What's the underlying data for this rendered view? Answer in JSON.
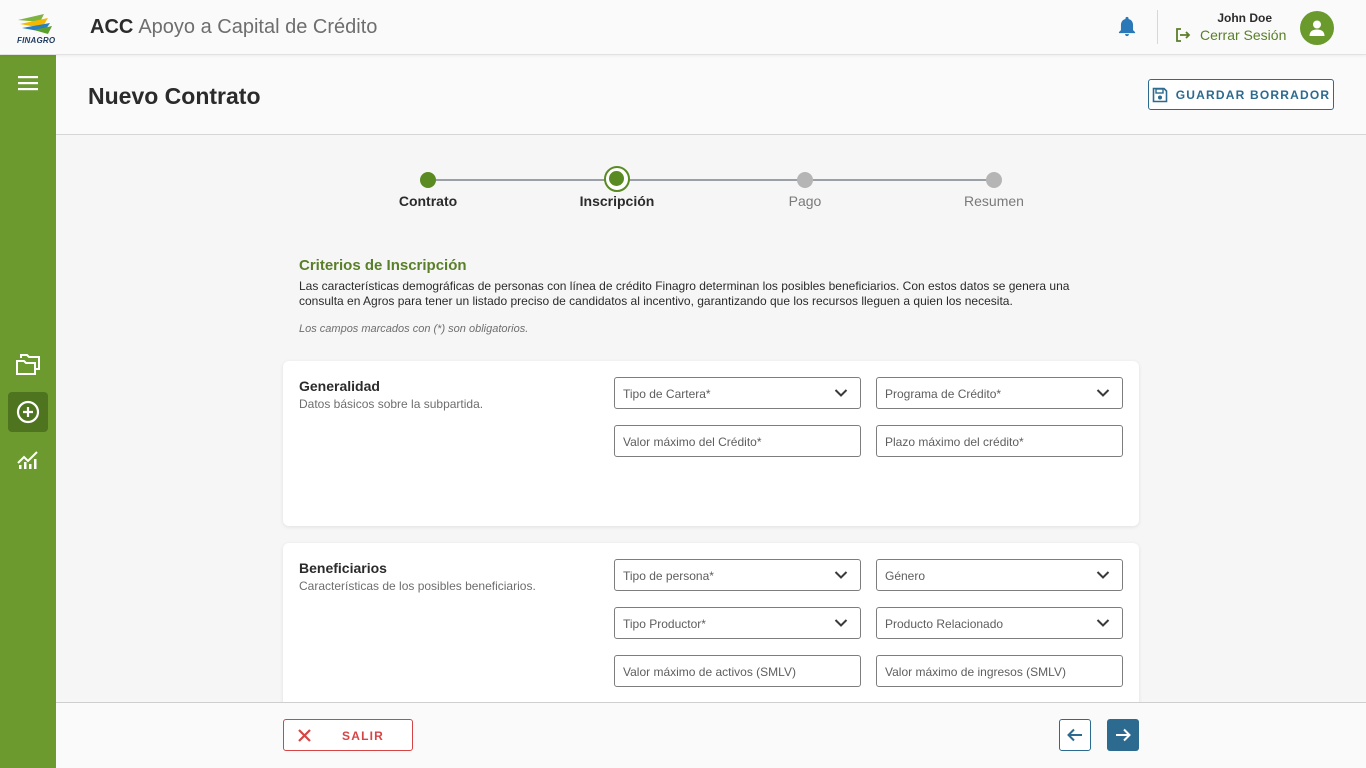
{
  "colors": {
    "brand_green": "#6d9a2f",
    "accent_blue": "#2c6a8f",
    "danger_red": "#d64545"
  },
  "header": {
    "logo_text": "FINAGRO",
    "app_code": "ACC",
    "app_name": "Apoyo a Capital de Crédito",
    "user_name": "John Doe",
    "logout_label": "Cerrar Sesión"
  },
  "sidebar": {
    "items": [
      {
        "icon": "menu-icon"
      },
      {
        "icon": "folders-icon"
      },
      {
        "icon": "add-circle-icon",
        "active": true
      },
      {
        "icon": "chart-icon"
      }
    ]
  },
  "page": {
    "title": "Nuevo Contrato",
    "save_draft_label": "GUARDAR BORRADOR"
  },
  "stepper": {
    "steps": [
      {
        "label": "Contrato",
        "status": "done"
      },
      {
        "label": "Inscripción",
        "status": "current"
      },
      {
        "label": "Pago",
        "status": "pending"
      },
      {
        "label": "Resumen",
        "status": "pending"
      }
    ]
  },
  "intro": {
    "title": "Criterios de Inscripción",
    "text": "Las características demográficas de personas con línea de crédito Finagro determinan los posibles beneficiarios. Con estos datos se genera una consulta en Agros para tener un listado preciso de candidatos al incentivo, garantizando que los recursos lleguen a quien los necesita.",
    "required_note": "Los campos marcados con (*) son obligatorios."
  },
  "sections": [
    {
      "title": "Generalidad",
      "subtitle": "Datos básicos sobre la subpartida.",
      "fields": [
        {
          "placeholder": "Tipo de Cartera*",
          "type": "select"
        },
        {
          "placeholder": "Programa de Crédito*",
          "type": "select"
        },
        {
          "placeholder": "Valor máximo del Crédito*",
          "type": "input"
        },
        {
          "placeholder": "Plazo máximo del crédito*",
          "type": "input"
        }
      ]
    },
    {
      "title": "Beneficiarios",
      "subtitle": "Características de los posibles beneficiarios.",
      "fields": [
        {
          "placeholder": "Tipo de persona*",
          "type": "select"
        },
        {
          "placeholder": "Género",
          "type": "select"
        },
        {
          "placeholder": "Tipo Productor*",
          "type": "select"
        },
        {
          "placeholder": "Producto Relacionado",
          "type": "select"
        },
        {
          "placeholder": "Valor máximo de activos (SMLV)",
          "type": "input"
        },
        {
          "placeholder": "Valor máximo de ingresos (SMLV)",
          "type": "input"
        }
      ]
    }
  ],
  "footer": {
    "exit_label": "SALIR"
  }
}
